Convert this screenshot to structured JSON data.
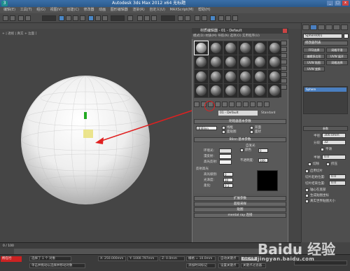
{
  "window": {
    "title": "Autodesk 3ds Max 2012 x64    无标题",
    "logo": "3",
    "minimize": "_",
    "maximize": "□",
    "close": "x"
  },
  "menubar": [
    "编辑(E)",
    "工具(T)",
    "组(G)",
    "视图(V)",
    "创建(C)",
    "修改器",
    "动画",
    "图形编辑器",
    "渲染(R)",
    "自定义(U)",
    "MAXScript(M)",
    "帮助(H)"
  ],
  "viewport": {
    "label": "+ | 透视 | 真实 + 边面 ]"
  },
  "material_editor": {
    "title": "材质编辑器 - 01 - Default",
    "menu": "模式(D)  材质(M)  导航(N)  选项(O)  实用程序(U)",
    "material_name": "01 - Default",
    "material_type": "Standard",
    "rollouts": {
      "shader_basic": "明暗器基本参数",
      "shader_type": "(B)Blinn",
      "blinn_basic": "Blinn 基本参数",
      "extended": "扩展参数",
      "supersampling": "超级采样",
      "maps": "贴图",
      "mental_ray": "mental ray 连接"
    },
    "options": {
      "wire": "线框",
      "two_sided": "双面",
      "face_map": "面贴图",
      "faceted": "面状"
    },
    "colors": {
      "ambient": "环境光:",
      "diffuse": "漫反射:",
      "specular": "高光反射:"
    },
    "self_illum": {
      "label": "自发光",
      "color": "颜色",
      "value": "0",
      "opacity_label": "不透明度:",
      "opacity": "100"
    },
    "specular_highlights": {
      "label": "反射高光",
      "level_label": "高光级别:",
      "level": "0",
      "gloss_label": "光泽度:",
      "gloss": "10",
      "soften_label": "柔化:",
      "soften": "0.1"
    }
  },
  "command_panel": {
    "object_name": "Sphere001",
    "modifier_list": "修改器列表",
    "buttons": [
      "FFD选择",
      "网格平滑",
      "编辑多边形",
      "UVW 展开",
      "UVW 贴图",
      "网格选择",
      "UVW 变换"
    ],
    "stack_item": "Sphere",
    "params_title": "参数",
    "radius_label": "半径:",
    "radius": "300.0mm",
    "segments_label": "分段:",
    "segments": "32",
    "smooth": "平滑",
    "hemisphere_label": "半球:",
    "hemisphere": "0.0",
    "chop": "切除",
    "squash": "挤压",
    "slice_on": "启用切片",
    "slice_from_label": "切片起始位置:",
    "slice_to_label": "切片结束位置:",
    "slice_from": "0.0",
    "slice_to": "0.0",
    "pivot_base": "轴心在底部",
    "gen_map": "生成贴图坐标",
    "real_world": "真实世界贴图大小"
  },
  "timeline": {
    "frame": "0 / 100"
  },
  "status": {
    "badge": "所在行",
    "selected": "选择了 1 个 对象",
    "prompt": "单击并拖动以选择并移动对象",
    "x": "X: 250.000mm",
    "y": "Y: 1000.797mm",
    "z": "Z: 0.0mm",
    "grid": "栅格 = 10.0mm",
    "autokey": "自动关键点",
    "selected_set": "选定对象",
    "add_time_tag": "添加时间标记",
    "set_key": "设置关键点",
    "key_filters": "关键点过滤器..."
  },
  "watermark": {
    "main": "Baidu 经验",
    "sub": "jingyan.baidu.com"
  },
  "colors": {
    "accent_blue": "#4a7fc0",
    "annotation_red": "#e02020"
  }
}
